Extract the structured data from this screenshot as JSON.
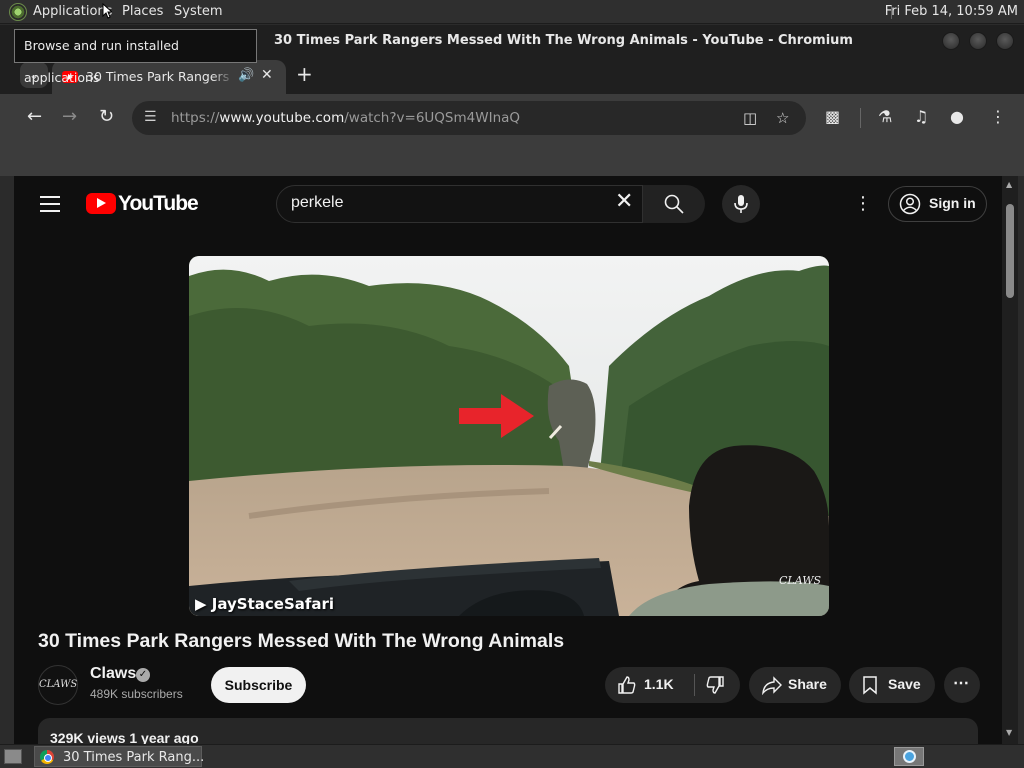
{
  "desktop": {
    "menu": {
      "applications": "Applications",
      "places": "Places",
      "system": "System"
    },
    "clock": "Fri Feb 14, 10:59 AM",
    "tooltip": "Browse and run installed applications"
  },
  "window": {
    "title": "30 Times Park Rangers Messed With The Wrong Animals - YouTube - Chromium"
  },
  "browser": {
    "tab": {
      "label": "30 Times Park Rangers Messed With The Wrong Animals"
    },
    "address": {
      "scheme": "https://",
      "host": "www.youtube.com",
      "path": "/watch?v=6UQSm4WInaQ"
    }
  },
  "youtube": {
    "wordmark": "YouTube",
    "search": {
      "value": "perkele"
    },
    "signin_label": "Sign in",
    "video": {
      "watermark": "JayStaceSafari",
      "channel_watermark": "CLAWS",
      "title": "30 Times Park Rangers Messed With The Wrong Animals"
    },
    "channel": {
      "name": "Claws",
      "subscribers": "489K subscribers",
      "avatar_text": "CLAWS"
    },
    "actions": {
      "subscribe": "Subscribe",
      "likes": "1.1K",
      "share": "Share",
      "save": "Save"
    },
    "description": {
      "stats": "329K views  1 year ago"
    }
  },
  "taskbar": {
    "task_label": "30 Times Park Rang..."
  },
  "colors": {
    "youtube_red": "#ff0000",
    "page_bg": "#0f0f0f",
    "toolbar_bg": "#3c3c3c",
    "arrow_red": "#e8242b"
  }
}
